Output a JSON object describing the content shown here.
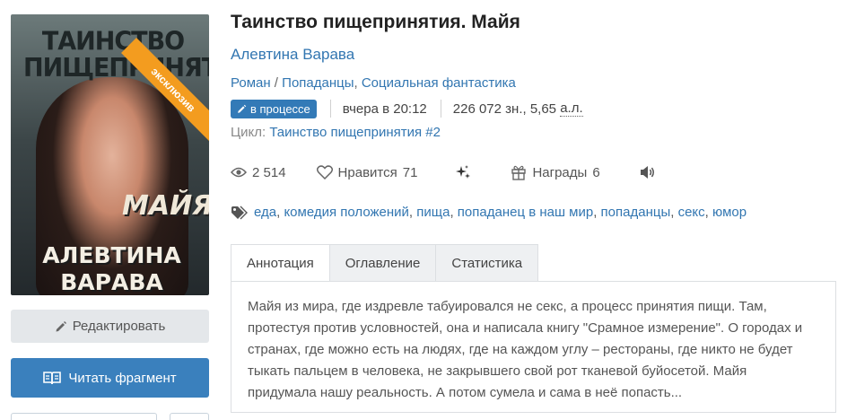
{
  "cover": {
    "badge": "эксклюзив",
    "title_line": "ТАИНСТВО ПИЩЕПРИНЯТИЯ",
    "subtitle": "МАЙЯ",
    "author_line": "АЛЕВТИНА ВАРАВА"
  },
  "buttons": {
    "edit": "Редактировать",
    "read": "Читать фрагмент"
  },
  "book": {
    "title": "Таинство пищепринятия. Майя",
    "author": "Алевтина Варава",
    "genres": [
      "Роман",
      "Попаданцы",
      "Социальная фантастика"
    ],
    "status": "в процессе",
    "updated": "вчера в 20:12",
    "size": "226 072 зн., 5,65",
    "size_unit": "а.л.",
    "cycle_label": "Цикл:",
    "cycle_name": "Таинство пищепринятия #2"
  },
  "stats": {
    "views": "2 514",
    "likes_label": "Нравится",
    "likes": "71",
    "awards_label": "Награды",
    "awards": "6"
  },
  "tags": [
    "еда",
    "комедия положений",
    "пища",
    "попаданец в наш мир",
    "попаданцы",
    "секс",
    "юмор"
  ],
  "tabs": [
    "Аннотация",
    "Оглавление",
    "Статистика"
  ],
  "annotation": "Майя из мира, где издревле табуировался не секс, а процесс принятия пищи. Там, протестуя против условностей, она и написала книгу \"Срамное измерение\". О городах и странах, где можно есть на людях, где на каждом углу – рестораны, где никто не будет тыкать пальцем в человека, не закрывшего свой рот тканевой буйосетой. Майя придумала нашу реальность. А потом сумела и сама в неё попасть...",
  "colors": {
    "link": "#3276b1",
    "badge": "#337ab7",
    "ribbon": "#f39c1f",
    "read_button": "#3a80bd"
  }
}
